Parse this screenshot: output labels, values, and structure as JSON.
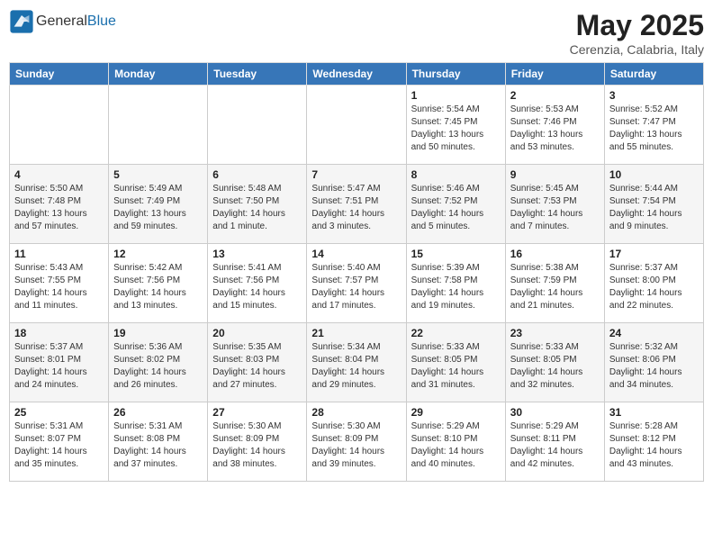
{
  "header": {
    "logo_general": "General",
    "logo_blue": "Blue",
    "month": "May 2025",
    "location": "Cerenzia, Calabria, Italy"
  },
  "days_of_week": [
    "Sunday",
    "Monday",
    "Tuesday",
    "Wednesday",
    "Thursday",
    "Friday",
    "Saturday"
  ],
  "weeks": [
    [
      {
        "day": "",
        "info": ""
      },
      {
        "day": "",
        "info": ""
      },
      {
        "day": "",
        "info": ""
      },
      {
        "day": "",
        "info": ""
      },
      {
        "day": "1",
        "info": "Sunrise: 5:54 AM\nSunset: 7:45 PM\nDaylight: 13 hours\nand 50 minutes."
      },
      {
        "day": "2",
        "info": "Sunrise: 5:53 AM\nSunset: 7:46 PM\nDaylight: 13 hours\nand 53 minutes."
      },
      {
        "day": "3",
        "info": "Sunrise: 5:52 AM\nSunset: 7:47 PM\nDaylight: 13 hours\nand 55 minutes."
      }
    ],
    [
      {
        "day": "4",
        "info": "Sunrise: 5:50 AM\nSunset: 7:48 PM\nDaylight: 13 hours\nand 57 minutes."
      },
      {
        "day": "5",
        "info": "Sunrise: 5:49 AM\nSunset: 7:49 PM\nDaylight: 13 hours\nand 59 minutes."
      },
      {
        "day": "6",
        "info": "Sunrise: 5:48 AM\nSunset: 7:50 PM\nDaylight: 14 hours\nand 1 minute."
      },
      {
        "day": "7",
        "info": "Sunrise: 5:47 AM\nSunset: 7:51 PM\nDaylight: 14 hours\nand 3 minutes."
      },
      {
        "day": "8",
        "info": "Sunrise: 5:46 AM\nSunset: 7:52 PM\nDaylight: 14 hours\nand 5 minutes."
      },
      {
        "day": "9",
        "info": "Sunrise: 5:45 AM\nSunset: 7:53 PM\nDaylight: 14 hours\nand 7 minutes."
      },
      {
        "day": "10",
        "info": "Sunrise: 5:44 AM\nSunset: 7:54 PM\nDaylight: 14 hours\nand 9 minutes."
      }
    ],
    [
      {
        "day": "11",
        "info": "Sunrise: 5:43 AM\nSunset: 7:55 PM\nDaylight: 14 hours\nand 11 minutes."
      },
      {
        "day": "12",
        "info": "Sunrise: 5:42 AM\nSunset: 7:56 PM\nDaylight: 14 hours\nand 13 minutes."
      },
      {
        "day": "13",
        "info": "Sunrise: 5:41 AM\nSunset: 7:56 PM\nDaylight: 14 hours\nand 15 minutes."
      },
      {
        "day": "14",
        "info": "Sunrise: 5:40 AM\nSunset: 7:57 PM\nDaylight: 14 hours\nand 17 minutes."
      },
      {
        "day": "15",
        "info": "Sunrise: 5:39 AM\nSunset: 7:58 PM\nDaylight: 14 hours\nand 19 minutes."
      },
      {
        "day": "16",
        "info": "Sunrise: 5:38 AM\nSunset: 7:59 PM\nDaylight: 14 hours\nand 21 minutes."
      },
      {
        "day": "17",
        "info": "Sunrise: 5:37 AM\nSunset: 8:00 PM\nDaylight: 14 hours\nand 22 minutes."
      }
    ],
    [
      {
        "day": "18",
        "info": "Sunrise: 5:37 AM\nSunset: 8:01 PM\nDaylight: 14 hours\nand 24 minutes."
      },
      {
        "day": "19",
        "info": "Sunrise: 5:36 AM\nSunset: 8:02 PM\nDaylight: 14 hours\nand 26 minutes."
      },
      {
        "day": "20",
        "info": "Sunrise: 5:35 AM\nSunset: 8:03 PM\nDaylight: 14 hours\nand 27 minutes."
      },
      {
        "day": "21",
        "info": "Sunrise: 5:34 AM\nSunset: 8:04 PM\nDaylight: 14 hours\nand 29 minutes."
      },
      {
        "day": "22",
        "info": "Sunrise: 5:33 AM\nSunset: 8:05 PM\nDaylight: 14 hours\nand 31 minutes."
      },
      {
        "day": "23",
        "info": "Sunrise: 5:33 AM\nSunset: 8:05 PM\nDaylight: 14 hours\nand 32 minutes."
      },
      {
        "day": "24",
        "info": "Sunrise: 5:32 AM\nSunset: 8:06 PM\nDaylight: 14 hours\nand 34 minutes."
      }
    ],
    [
      {
        "day": "25",
        "info": "Sunrise: 5:31 AM\nSunset: 8:07 PM\nDaylight: 14 hours\nand 35 minutes."
      },
      {
        "day": "26",
        "info": "Sunrise: 5:31 AM\nSunset: 8:08 PM\nDaylight: 14 hours\nand 37 minutes."
      },
      {
        "day": "27",
        "info": "Sunrise: 5:30 AM\nSunset: 8:09 PM\nDaylight: 14 hours\nand 38 minutes."
      },
      {
        "day": "28",
        "info": "Sunrise: 5:30 AM\nSunset: 8:09 PM\nDaylight: 14 hours\nand 39 minutes."
      },
      {
        "day": "29",
        "info": "Sunrise: 5:29 AM\nSunset: 8:10 PM\nDaylight: 14 hours\nand 40 minutes."
      },
      {
        "day": "30",
        "info": "Sunrise: 5:29 AM\nSunset: 8:11 PM\nDaylight: 14 hours\nand 42 minutes."
      },
      {
        "day": "31",
        "info": "Sunrise: 5:28 AM\nSunset: 8:12 PM\nDaylight: 14 hours\nand 43 minutes."
      }
    ]
  ]
}
